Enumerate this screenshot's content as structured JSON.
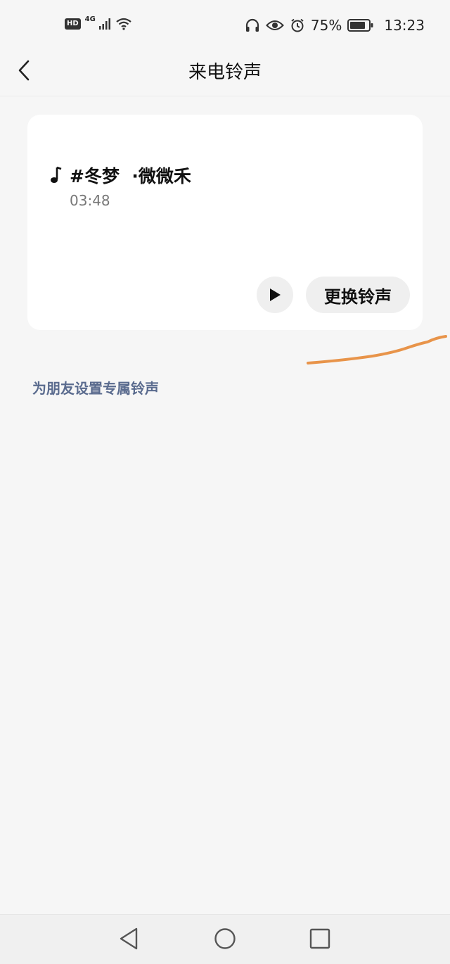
{
  "status_bar": {
    "hd_badge": "HD",
    "network": "4G",
    "battery_percent": "75%",
    "time": "13:23",
    "icons": [
      "signal-icon",
      "wifi-icon",
      "headphones-icon",
      "eye-icon",
      "alarm-icon",
      "battery-icon"
    ]
  },
  "header": {
    "title": "来电铃声",
    "back_icon": "chevron-left-icon"
  },
  "ringtone_card": {
    "song_title": "#冬梦  ·微微禾",
    "duration": "03:48",
    "play_icon": "play-icon",
    "change_button_label": "更换铃声"
  },
  "friend_ringtone_link": "为朋友设置专属铃声",
  "annotation": {
    "color": "#e8944a"
  },
  "nav_bar": {
    "items": [
      "back-triangle-icon",
      "home-circle-icon",
      "recents-square-icon"
    ]
  },
  "colors": {
    "background": "#f6f6f6",
    "card": "#ffffff",
    "link": "#5a6b8e"
  }
}
